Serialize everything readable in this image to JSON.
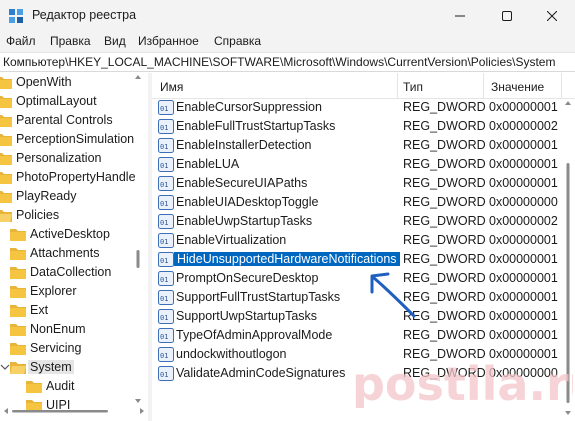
{
  "window": {
    "title": "Редактор реестра"
  },
  "menu": [
    "Файл",
    "Правка",
    "Вид",
    "Избранное",
    "Справка"
  ],
  "address": "Компьютер\\HKEY_LOCAL_MACHINE\\SOFTWARE\\Microsoft\\Windows\\CurrentVersion\\Policies\\System",
  "tree": [
    {
      "label": "OpenWith",
      "level": 0
    },
    {
      "label": "OptimalLayout",
      "level": 0
    },
    {
      "label": "Parental Controls",
      "level": 0
    },
    {
      "label": "PerceptionSimulation",
      "level": 0
    },
    {
      "label": "Personalization",
      "level": 0
    },
    {
      "label": "PhotoPropertyHandle",
      "level": 0
    },
    {
      "label": "PlayReady",
      "level": 0
    },
    {
      "label": "Policies",
      "level": 0
    },
    {
      "label": "ActiveDesktop",
      "level": 1
    },
    {
      "label": "Attachments",
      "level": 1
    },
    {
      "label": "DataCollection",
      "level": 1
    },
    {
      "label": "Explorer",
      "level": 1
    },
    {
      "label": "Ext",
      "level": 1
    },
    {
      "label": "NonEnum",
      "level": 1
    },
    {
      "label": "Servicing",
      "level": 1
    },
    {
      "label": "System",
      "level": 1,
      "selected": true,
      "expanded": true
    },
    {
      "label": "Audit",
      "level": 2
    },
    {
      "label": "UIPI",
      "level": 2
    }
  ],
  "list": {
    "headers": {
      "name": "Имя",
      "type": "Тип",
      "value": "Значение"
    },
    "rows": [
      {
        "name": "EnableCursorSuppression",
        "type": "REG_DWORD",
        "value": "0x00000001"
      },
      {
        "name": "EnableFullTrustStartupTasks",
        "type": "REG_DWORD",
        "value": "0x00000002"
      },
      {
        "name": "EnableInstallerDetection",
        "type": "REG_DWORD",
        "value": "0x00000001"
      },
      {
        "name": "EnableLUA",
        "type": "REG_DWORD",
        "value": "0x00000001"
      },
      {
        "name": "EnableSecureUIAPaths",
        "type": "REG_DWORD",
        "value": "0x00000001"
      },
      {
        "name": "EnableUIADesktopToggle",
        "type": "REG_DWORD",
        "value": "0x00000000"
      },
      {
        "name": "EnableUwpStartupTasks",
        "type": "REG_DWORD",
        "value": "0x00000002"
      },
      {
        "name": "EnableVirtualization",
        "type": "REG_DWORD",
        "value": "0x00000001"
      },
      {
        "name": "HideUnsupportedHardwareNotifications",
        "type": "REG_DWORD",
        "value": "0x00000001",
        "selected": true
      },
      {
        "name": "PromptOnSecureDesktop",
        "type": "REG_DWORD",
        "value": "0x00000001"
      },
      {
        "name": "SupportFullTrustStartupTasks",
        "type": "REG_DWORD",
        "value": "0x00000001"
      },
      {
        "name": "SupportUwpStartupTasks",
        "type": "REG_DWORD",
        "value": "0x00000001"
      },
      {
        "name": "TypeOfAdminApprovalMode",
        "type": "REG_DWORD",
        "value": "0x00000001"
      },
      {
        "name": "undockwithoutlogon",
        "type": "REG_DWORD",
        "value": "0x00000001"
      },
      {
        "name": "ValidateAdminCodeSignatures",
        "type": "REG_DWORD",
        "value": "0x00000000"
      }
    ]
  },
  "watermark": "postila.ru",
  "colors": {
    "selection": "#0067c0",
    "annotation_arrow": "#1f5fbf",
    "watermark": "#f3c4c8",
    "folder": "#f5c542"
  }
}
